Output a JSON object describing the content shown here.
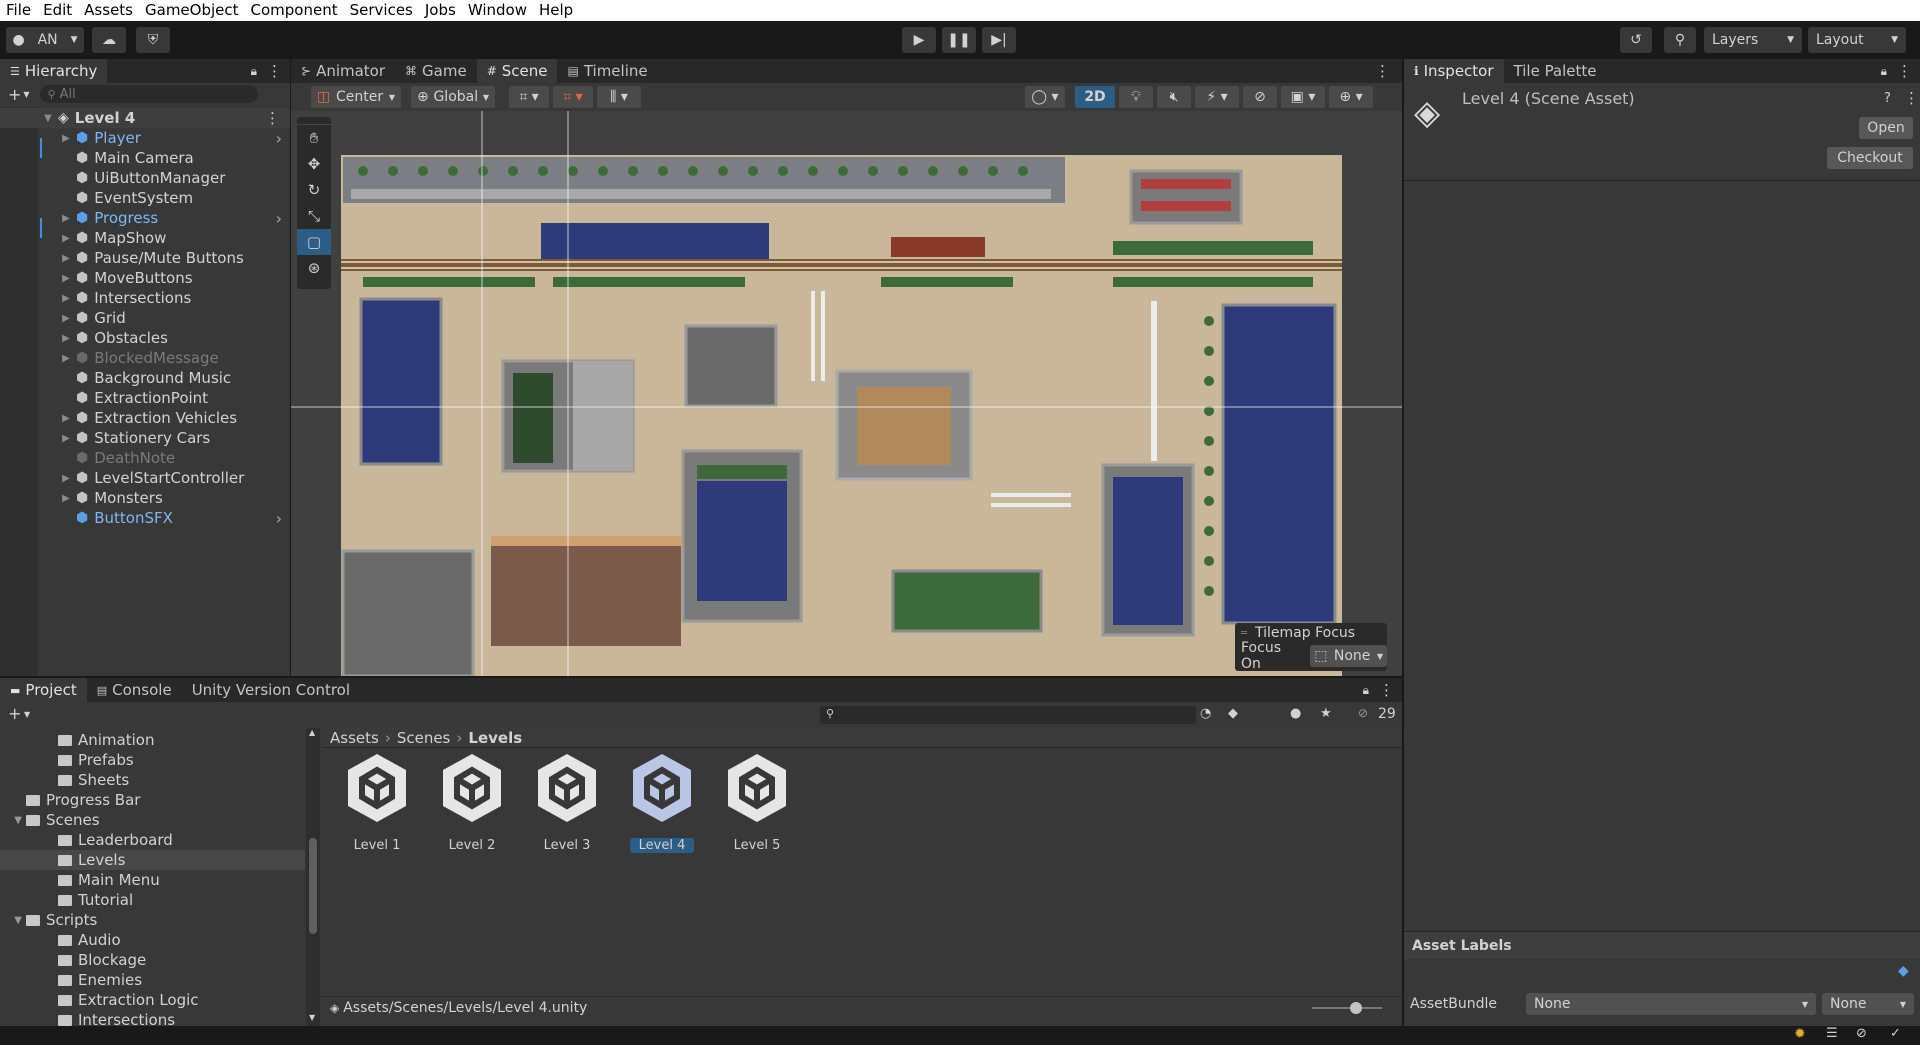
{
  "menu": [
    "File",
    "Edit",
    "Assets",
    "GameObject",
    "Component",
    "Services",
    "Jobs",
    "Window",
    "Help"
  ],
  "toolbar": {
    "account": "AN",
    "layers_label": "Layers",
    "layout_label": "Layout"
  },
  "hierarchy": {
    "tab": "Hierarchy",
    "search_placeholder": "All",
    "scene": "Level 4",
    "items": [
      {
        "label": "Player",
        "prefab": true,
        "expand": true
      },
      {
        "label": "Main Camera"
      },
      {
        "label": "UiButtonManager"
      },
      {
        "label": "EventSystem"
      },
      {
        "label": "Progress",
        "prefab": true,
        "expand": true
      },
      {
        "label": "MapShow",
        "expand": true
      },
      {
        "label": "Pause/Mute Buttons",
        "expand": true
      },
      {
        "label": "MoveButtons",
        "expand": true
      },
      {
        "label": "Intersections",
        "expand": true
      },
      {
        "label": "Grid",
        "expand": true
      },
      {
        "label": "Obstacles",
        "expand": true
      },
      {
        "label": "BlockedMessage",
        "expand": true,
        "disabled": true
      },
      {
        "label": "Background Music"
      },
      {
        "label": "ExtractionPoint"
      },
      {
        "label": "Extraction Vehicles",
        "expand": true
      },
      {
        "label": "Stationery Cars",
        "expand": true
      },
      {
        "label": "DeathNote",
        "disabled": true
      },
      {
        "label": "LevelStartController",
        "expand": true
      },
      {
        "label": "Monsters",
        "expand": true
      },
      {
        "label": "ButtonSFX",
        "prefab": true
      }
    ]
  },
  "center_tabs": [
    "Animator",
    "Game",
    "Scene",
    "Timeline"
  ],
  "scene_toolbar": {
    "pivot": "Center",
    "space": "Global",
    "mode_2d": "2D"
  },
  "overlay": {
    "title": "Tilemap Focus",
    "focus_label": "Focus On",
    "focus_value": "None"
  },
  "inspector": {
    "tabs": [
      "Inspector",
      "Tile Palette"
    ],
    "title": "Level 4 (Scene Asset)",
    "open_btn": "Open",
    "checkout_btn": "Checkout",
    "asset_labels": "Asset Labels",
    "assetbundle_label": "AssetBundle",
    "assetbundle_value": "None",
    "variant_value": "None"
  },
  "project": {
    "tabs": [
      "Project",
      "Console",
      "Unity Version Control"
    ],
    "hidden_count": "29",
    "breadcrumb": [
      "Assets",
      "Scenes",
      "Levels"
    ],
    "tree": [
      {
        "label": "Animation",
        "indent": 2
      },
      {
        "label": "Prefabs",
        "indent": 2
      },
      {
        "label": "Sheets",
        "indent": 2
      },
      {
        "label": "Progress Bar",
        "indent": 1
      },
      {
        "label": "Scenes",
        "indent": 1,
        "open": true
      },
      {
        "label": "Leaderboard",
        "indent": 2
      },
      {
        "label": "Levels",
        "indent": 2,
        "selected": true
      },
      {
        "label": "Main Menu",
        "indent": 2
      },
      {
        "label": "Tutorial",
        "indent": 2
      },
      {
        "label": "Scripts",
        "indent": 1,
        "open": true
      },
      {
        "label": "Audio",
        "indent": 2
      },
      {
        "label": "Blockage",
        "indent": 2
      },
      {
        "label": "Enemies",
        "indent": 2
      },
      {
        "label": "Extraction Logic",
        "indent": 2
      },
      {
        "label": "Intersections",
        "indent": 2
      }
    ],
    "assets": [
      "Level 1",
      "Level 2",
      "Level 3",
      "Level 4",
      "Level 5"
    ],
    "selected_asset": "Level 4",
    "path": "Assets/Scenes/Levels/Level 4.unity"
  },
  "colors": {
    "accent": "#2c5d87",
    "prefab": "#7cb8ef",
    "ground": "#c9b79a",
    "water": "#2e3b7a"
  }
}
